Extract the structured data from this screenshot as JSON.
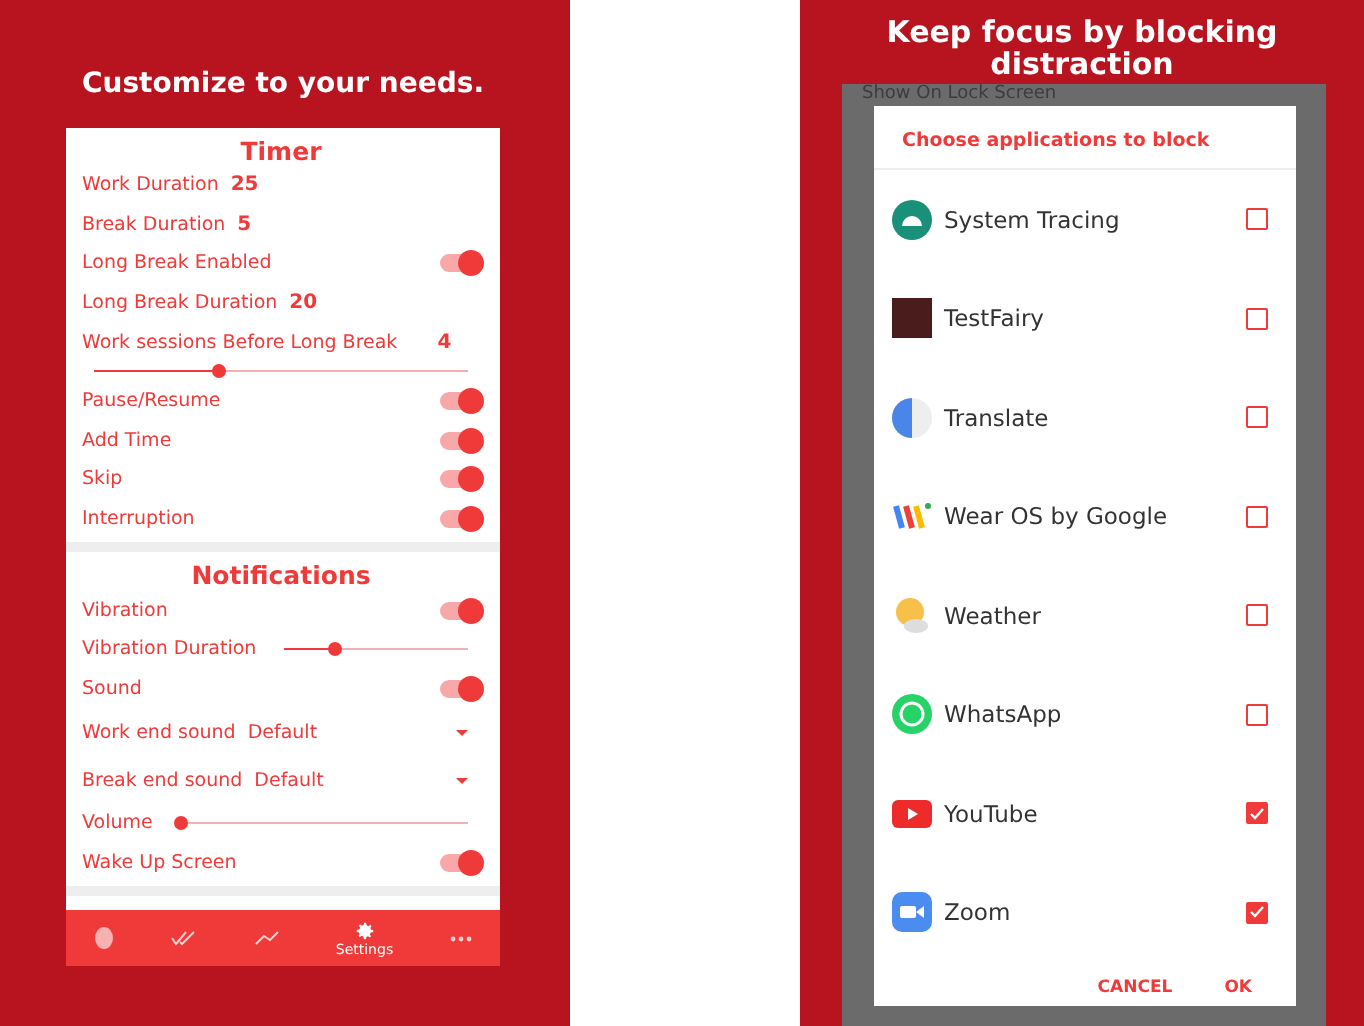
{
  "left": {
    "headline": "Customize to your needs.",
    "sections": [
      {
        "title": "Timer",
        "rows": [
          {
            "kind": "value",
            "label": "Work Duration",
            "value": "25"
          },
          {
            "kind": "value",
            "label": "Break Duration",
            "value": "5"
          },
          {
            "kind": "toggle",
            "label": "Long Break Enabled",
            "on": true
          },
          {
            "kind": "value",
            "label": "Long Break Duration",
            "value": "20"
          },
          {
            "kind": "value_slider",
            "label": "Work sessions Before Long Break",
            "value": "4",
            "level": 0.33
          },
          {
            "kind": "toggle",
            "label": "Pause/Resume",
            "on": true
          },
          {
            "kind": "toggle",
            "label": "Add Time",
            "on": true
          },
          {
            "kind": "toggle",
            "label": "Skip",
            "on": true
          },
          {
            "kind": "toggle",
            "label": "Interruption",
            "on": true
          }
        ]
      },
      {
        "title": "Notifications",
        "rows": [
          {
            "kind": "toggle",
            "label": "Vibration",
            "on": true
          },
          {
            "kind": "slider",
            "label": "Vibration Duration",
            "level": 0.27
          },
          {
            "kind": "toggle",
            "label": "Sound",
            "on": true
          },
          {
            "kind": "dropdown",
            "label": "Work end sound",
            "value": "Default"
          },
          {
            "kind": "dropdown",
            "label": "Break end sound",
            "value": "Default"
          },
          {
            "kind": "slider",
            "label": "Volume",
            "level": 0
          },
          {
            "kind": "toggle",
            "label": "Wake Up Screen",
            "on": true
          }
        ]
      }
    ],
    "nav": [
      {
        "selected": false
      },
      {
        "selected": false
      },
      {
        "selected": false
      },
      {
        "label": "Settings",
        "selected": true
      },
      {
        "selected": false
      }
    ]
  },
  "right": {
    "headline": "Keep focus by blocking distraction",
    "background_text": "Show On Lock Screen",
    "dialog": {
      "title": "Choose applications to block",
      "apps": [
        {
          "name": "System Tracing",
          "checked": false
        },
        {
          "name": "TestFairy",
          "checked": false
        },
        {
          "name": "Translate",
          "checked": false
        },
        {
          "name": "Wear OS by Google",
          "checked": false
        },
        {
          "name": "Weather",
          "checked": false
        },
        {
          "name": "WhatsApp",
          "checked": false
        },
        {
          "name": "YouTube",
          "checked": true
        },
        {
          "name": "Zoom",
          "checked": true
        }
      ],
      "buttons": [
        "CANCEL",
        "OK"
      ]
    }
  }
}
